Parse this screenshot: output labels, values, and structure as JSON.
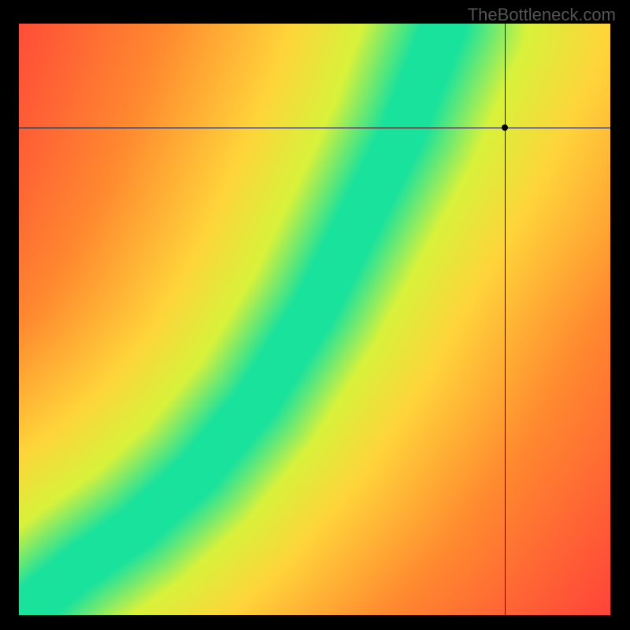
{
  "watermark": "TheBottleneck.com",
  "chart_data": {
    "type": "heatmap",
    "title": "",
    "xlabel": "",
    "ylabel": "",
    "xlim": [
      0,
      1
    ],
    "ylim": [
      0,
      1
    ],
    "crosshair": {
      "x": 0.82,
      "y": 0.825
    },
    "optimal_curve": {
      "description": "Green optimal band — estimated center points (x, y)",
      "points": [
        [
          0.0,
          0.0
        ],
        [
          0.1,
          0.08
        ],
        [
          0.2,
          0.15
        ],
        [
          0.3,
          0.24
        ],
        [
          0.4,
          0.36
        ],
        [
          0.5,
          0.52
        ],
        [
          0.55,
          0.62
        ],
        [
          0.6,
          0.72
        ],
        [
          0.65,
          0.82
        ],
        [
          0.68,
          0.9
        ],
        [
          0.72,
          1.0
        ]
      ],
      "band_half_width": 0.06
    },
    "colormap": {
      "description": "Distance from optimal curve mapped green→yellow→orange→red",
      "stops": [
        {
          "d": 0.0,
          "color": "#19e29c"
        },
        {
          "d": 0.08,
          "color": "#d8f23a"
        },
        {
          "d": 0.18,
          "color": "#ffd43a"
        },
        {
          "d": 0.35,
          "color": "#ff8a2f"
        },
        {
          "d": 0.6,
          "color": "#ff3e3a"
        },
        {
          "d": 1.0,
          "color": "#ff163a"
        }
      ]
    },
    "grid": false,
    "legend": null
  }
}
